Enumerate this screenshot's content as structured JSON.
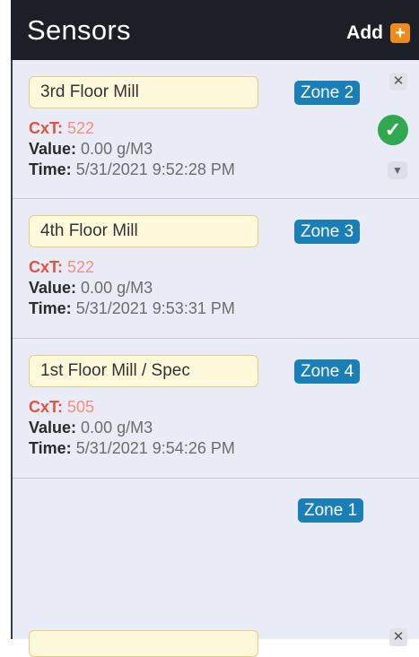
{
  "header": {
    "title": "Sensors",
    "add_label": "Add",
    "add_icon": "+"
  },
  "labels": {
    "cxt": "CxT:",
    "value": "Value:",
    "time": "Time:"
  },
  "sensors": [
    {
      "name": "3rd Floor Mill",
      "zone": "Zone 2",
      "cxt": "522",
      "value": "0.00 g/M3",
      "time": "5/31/2021 9:52:28 PM"
    },
    {
      "name": "4th Floor Mill",
      "zone": "Zone 3",
      "cxt": "522",
      "value": "0.00 g/M3",
      "time": "5/31/2021 9:53:31 PM"
    },
    {
      "name": "1st Floor Mill / Spec",
      "zone": "Zone 4",
      "cxt": "505",
      "value": "0.00 g/M3",
      "time": "5/31/2021 9:54:26 PM"
    },
    {
      "zone": "Zone 1"
    }
  ],
  "icons": {
    "close": "close-icon",
    "check": "check-circle-icon",
    "chevron": "chevron-down-icon",
    "add": "plus-square-icon"
  },
  "colors": {
    "header_bg": "#1c1f26",
    "panel_bg": "#e9ebf6",
    "zone_badge": "#1a7fb6",
    "cxt": "#e0533f",
    "add_accent": "#f08a1a",
    "ok_green": "#2fa84f"
  }
}
